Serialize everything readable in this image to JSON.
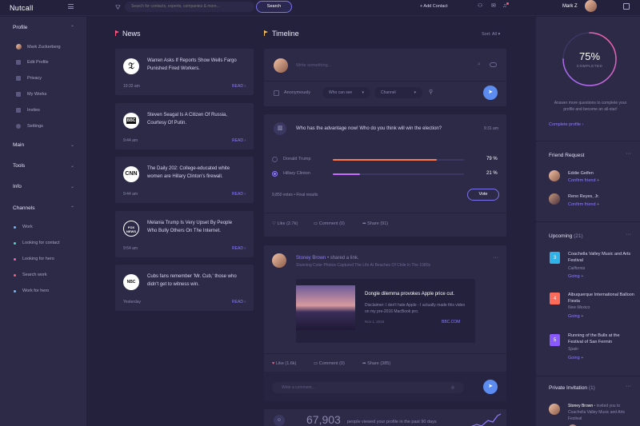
{
  "app": {
    "title": "Nutcall"
  },
  "topbar": {
    "search_placeholder": "Search for contacts, experts, companies & more...",
    "search_button": "Search",
    "add_contact": "+ Add Contact",
    "user_name": "Mark Z"
  },
  "sidebar": {
    "profile_label": "Profile",
    "profile_items": [
      {
        "label": "Mark Zuckerberg",
        "icon": "avatar"
      },
      {
        "label": "Edit Profile",
        "icon": "edit-icon"
      },
      {
        "label": "Privacy",
        "icon": "lock-icon"
      },
      {
        "label": "My Works",
        "icon": "briefcase-icon"
      },
      {
        "label": "Invites",
        "icon": "invite-icon"
      },
      {
        "label": "Settings",
        "icon": "gear-icon"
      }
    ],
    "sections": [
      "Main",
      "Tools",
      "Info"
    ],
    "channels_label": "Channels",
    "channels": [
      {
        "label": "Work",
        "color": "#5ec1ff"
      },
      {
        "label": "Looking for contact",
        "color": "#3fe0c0"
      },
      {
        "label": "Looking for hero",
        "color": "#ff5fa2"
      },
      {
        "label": "Search work",
        "color": "#ff5a6e"
      },
      {
        "label": "Work for hero",
        "color": "#5ec1ff"
      }
    ]
  },
  "news": {
    "title": "News",
    "read_label": "READ ›",
    "items": [
      {
        "logo": "NYT",
        "text": "Warren Asks If Reports Show Wells Fargo Punished Fired Workers.",
        "time": "10:32 am"
      },
      {
        "logo": "BBC",
        "text": "Steven Seagal Is A Citizen Of Russia, Courtesy Of Putin.",
        "time": "9:44 am"
      },
      {
        "logo": "CNN",
        "text": "The Daily 202: College-educated white women are Hillary Clinton's firewall.",
        "time": "9:44 am"
      },
      {
        "logo": "FOX NEWS",
        "text": "Melania Trump Is Very Upset By People Who Bully Others On The Internet.",
        "time": "9:54 am"
      },
      {
        "logo": "NBC",
        "text": "Cubs fans remember 'Mr. Cub,' those who didn't get to witness win.",
        "time": "Yesterday"
      }
    ]
  },
  "timeline": {
    "title": "Timeline",
    "sort_label": "Sort: All",
    "composer": {
      "placeholder": "Write something...",
      "anonymous": "Anonymously",
      "who_can_see": "Who can see",
      "channel": "Channel"
    },
    "poll": {
      "question": "Who has the advantage now! Who do you think will win the election?",
      "time": "9:31 am",
      "options": [
        {
          "label": "Donald Trump",
          "percent_text": "79 %",
          "value": 79,
          "color": "#ff7a4a"
        },
        {
          "label": "Hillary Clinton",
          "percent_text": "21 %",
          "value": 21,
          "color": "#c86bff"
        }
      ],
      "votes": "9,850 votes • Final results",
      "vote_button": "Vote",
      "like": "Like (2.7k)",
      "comment": "Comment (0)",
      "share": "Share (91)"
    },
    "post": {
      "author": "Stoney Brown",
      "action": "• shared a link.",
      "subtitle": "Stunning Color Photos Captured The Life At Beaches Of Chile In The 1980s",
      "link_title": "Dongle dilemma provokes Apple price cut.",
      "link_desc": "Disclaimer: I don't hate Apple - I actually made this video on my pre-2016 MacBook pro.",
      "link_date": "Nov 1, 2016",
      "link_site": "BBC.COM",
      "like": "Like (1.6k)",
      "comment": "Comment (0)",
      "share": "Share (385)",
      "comment_placeholder": "Write a comment..."
    },
    "stats": {
      "number": "67,903",
      "text": "people viewed your profile in the past 90 days"
    }
  },
  "right": {
    "progress": {
      "percent_text": "75%",
      "value": 75,
      "label": "COMPLETED",
      "text": "Answer more questions to complete your profile and become an all-star!",
      "link": "Complete profile ›"
    },
    "friend_request": {
      "title": "Friend Request",
      "items": [
        {
          "name": "Eddie Geifen",
          "action": "Confirm friend +"
        },
        {
          "name": "Reno Reyes, Jr.",
          "action": "Confirm friend +"
        }
      ]
    },
    "upcoming": {
      "title": "Upcoming",
      "count": "(21)",
      "items": [
        {
          "day": "3",
          "color": "#2fb3e8",
          "title": "Coachella Valley Music and Arts Festival",
          "place": "California",
          "action": "Going +"
        },
        {
          "day": "4",
          "color": "#ff6b5a",
          "title": "Albuquerque International Balloon Fiesta",
          "place": "New Mexico",
          "action": "Going +"
        },
        {
          "day": "5",
          "color": "#8a58ff",
          "title": "Running of the Bulls at the Festival of San Fermin",
          "place": "Spain",
          "action": "Going +"
        }
      ]
    },
    "invitation": {
      "title": "Private Invitation",
      "count": "(1)",
      "name": "Stoney Brown",
      "text": "• invited you to Coachella Valley Music and Arts Festival"
    }
  }
}
